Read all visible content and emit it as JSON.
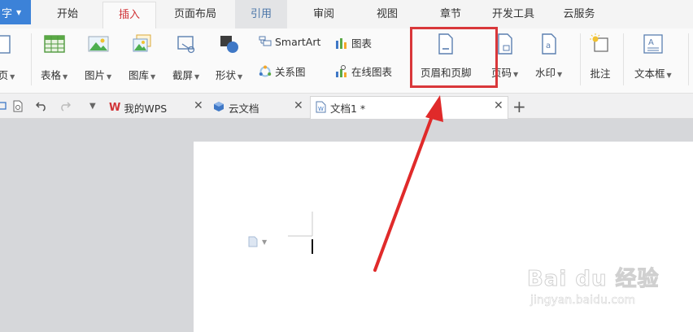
{
  "menubar": {
    "app_label": "字",
    "tabs": [
      {
        "label": "开始"
      },
      {
        "label": "插入"
      },
      {
        "label": "页面布局"
      },
      {
        "label": "引用"
      },
      {
        "label": "审阅"
      },
      {
        "label": "视图"
      },
      {
        "label": "章节"
      },
      {
        "label": "开发工具"
      },
      {
        "label": "云服务"
      }
    ],
    "active_tab": "插入"
  },
  "ribbon": {
    "partial_page_label": "页",
    "table": "表格",
    "picture": "图片",
    "gallery": "图库",
    "screenshot": "截屏",
    "shapes": "形状",
    "smartart": "SmartArt",
    "relation": "关系图",
    "chart": "图表",
    "online_chart": "在线图表",
    "header_footer": "页眉和页脚",
    "page_number": "页码",
    "watermark": "水印",
    "comment": "批注",
    "textbox": "文本框"
  },
  "tabbar": {
    "tabs": [
      {
        "label": "我的WPS"
      },
      {
        "label": "云文档"
      },
      {
        "label": "文档1 *"
      }
    ]
  },
  "site_watermark": {
    "brand": "Bai du 经验",
    "url": "jingyan.baidu.com"
  },
  "colors": {
    "accent_red": "#d13438",
    "highlight": "#d9373a",
    "app_blue": "#3c82d8"
  }
}
